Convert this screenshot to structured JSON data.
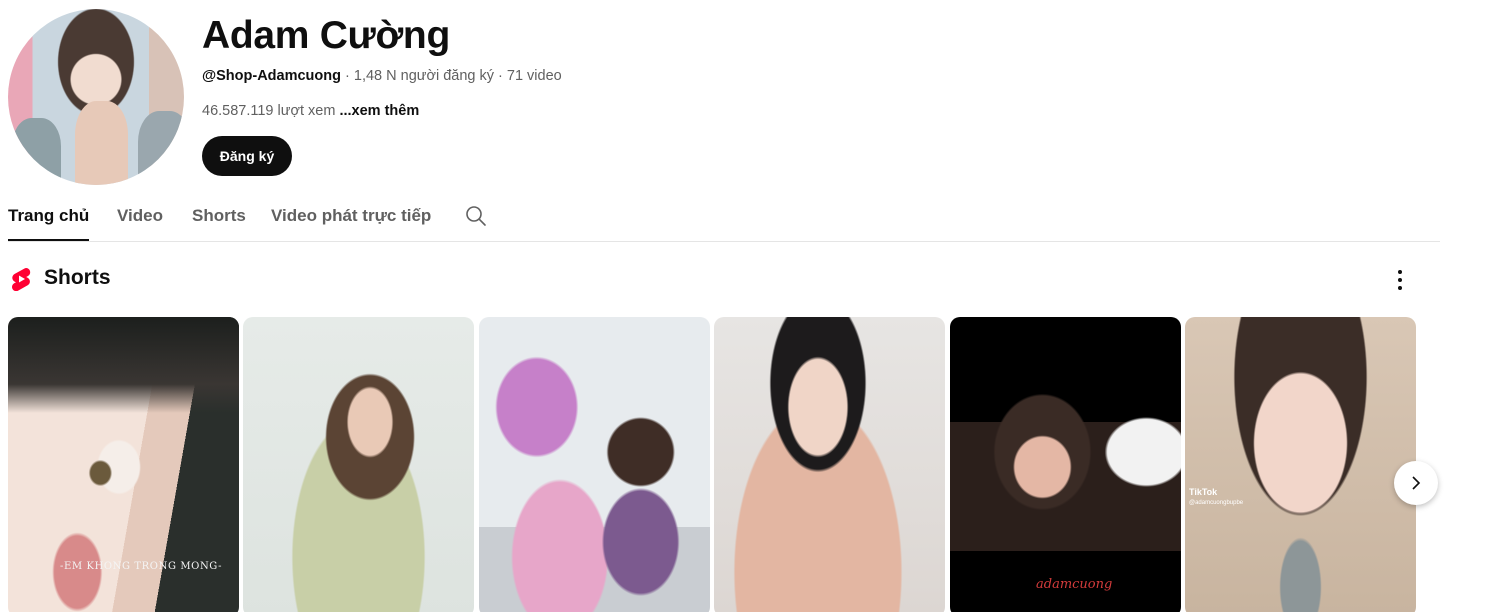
{
  "channel": {
    "name": "Adam Cường",
    "handle": "@Shop-Adamcuong",
    "meta_rest": " · 1,48 N người đăng ký · 71 video",
    "views": "46.587.119 lượt xem ",
    "more_label": "...xem thêm",
    "subscribe_label": "Đăng ký",
    "avatar_icon": "channel-avatar"
  },
  "tabs": [
    {
      "label": "Trang chủ",
      "active": true
    },
    {
      "label": "Video",
      "active": false
    },
    {
      "label": "Shorts",
      "active": false
    },
    {
      "label": "Video phát trực tiếp",
      "active": false
    }
  ],
  "section": {
    "title": "Shorts",
    "icon": "shorts-icon",
    "menu_icon": "more-vert-icon"
  },
  "shorts": [
    {
      "caption": "-EM KHONG TRONG MONG-"
    },
    {
      "caption": ""
    },
    {
      "caption": ""
    },
    {
      "caption": ""
    },
    {
      "caption": "adamcuong"
    },
    {
      "caption": "TikTok",
      "sub": "@adamcuongbupbe"
    }
  ],
  "colors": {
    "shorts_red": "#ff0033",
    "subscribe_bg": "#0f0f0f",
    "secondary_text": "#606060"
  }
}
